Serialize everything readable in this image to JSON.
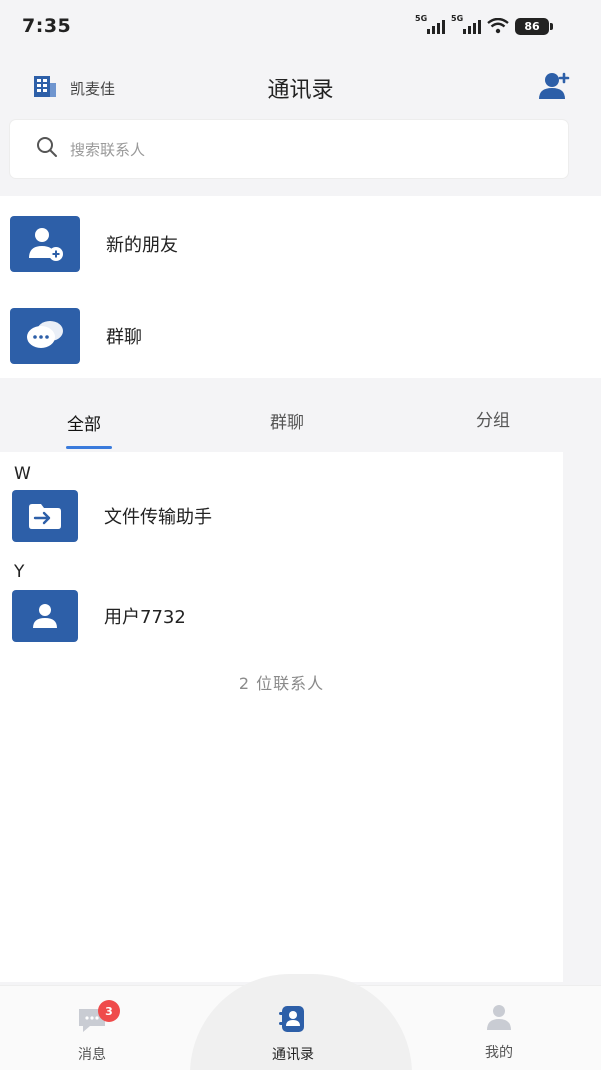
{
  "status_bar": {
    "time": "7:35",
    "network_1": "5G",
    "network_2": "5G",
    "battery": "86"
  },
  "header": {
    "org_name": "凯麦佳",
    "title": "通讯录"
  },
  "search": {
    "placeholder": "搜索联系人"
  },
  "quick_actions": [
    {
      "label": "新的朋友",
      "icon": "add-person-icon"
    },
    {
      "label": "群聊",
      "icon": "chat-bubbles-icon"
    }
  ],
  "tabs": [
    {
      "label": "全部",
      "active": true
    },
    {
      "label": "群聊",
      "active": false
    },
    {
      "label": "分组",
      "active": false
    }
  ],
  "contacts": {
    "sections": [
      {
        "letter": "W",
        "items": [
          {
            "name": "文件传输助手",
            "icon": "folder-transfer-icon"
          }
        ]
      },
      {
        "letter": "Y",
        "items": [
          {
            "name": "用户7732",
            "icon": "user-icon"
          }
        ]
      }
    ],
    "count_text": "2 位联系人"
  },
  "bottom_nav": [
    {
      "label": "消息",
      "badge": "3",
      "icon": "message-icon",
      "active": false
    },
    {
      "label": "通讯录",
      "icon": "contacts-book-icon",
      "active": true
    },
    {
      "label": "我的",
      "icon": "profile-icon",
      "active": false
    }
  ],
  "colors": {
    "accent": "#2d5fa8",
    "tab_indicator": "#3a7bdc",
    "badge": "#ef4b4b"
  }
}
